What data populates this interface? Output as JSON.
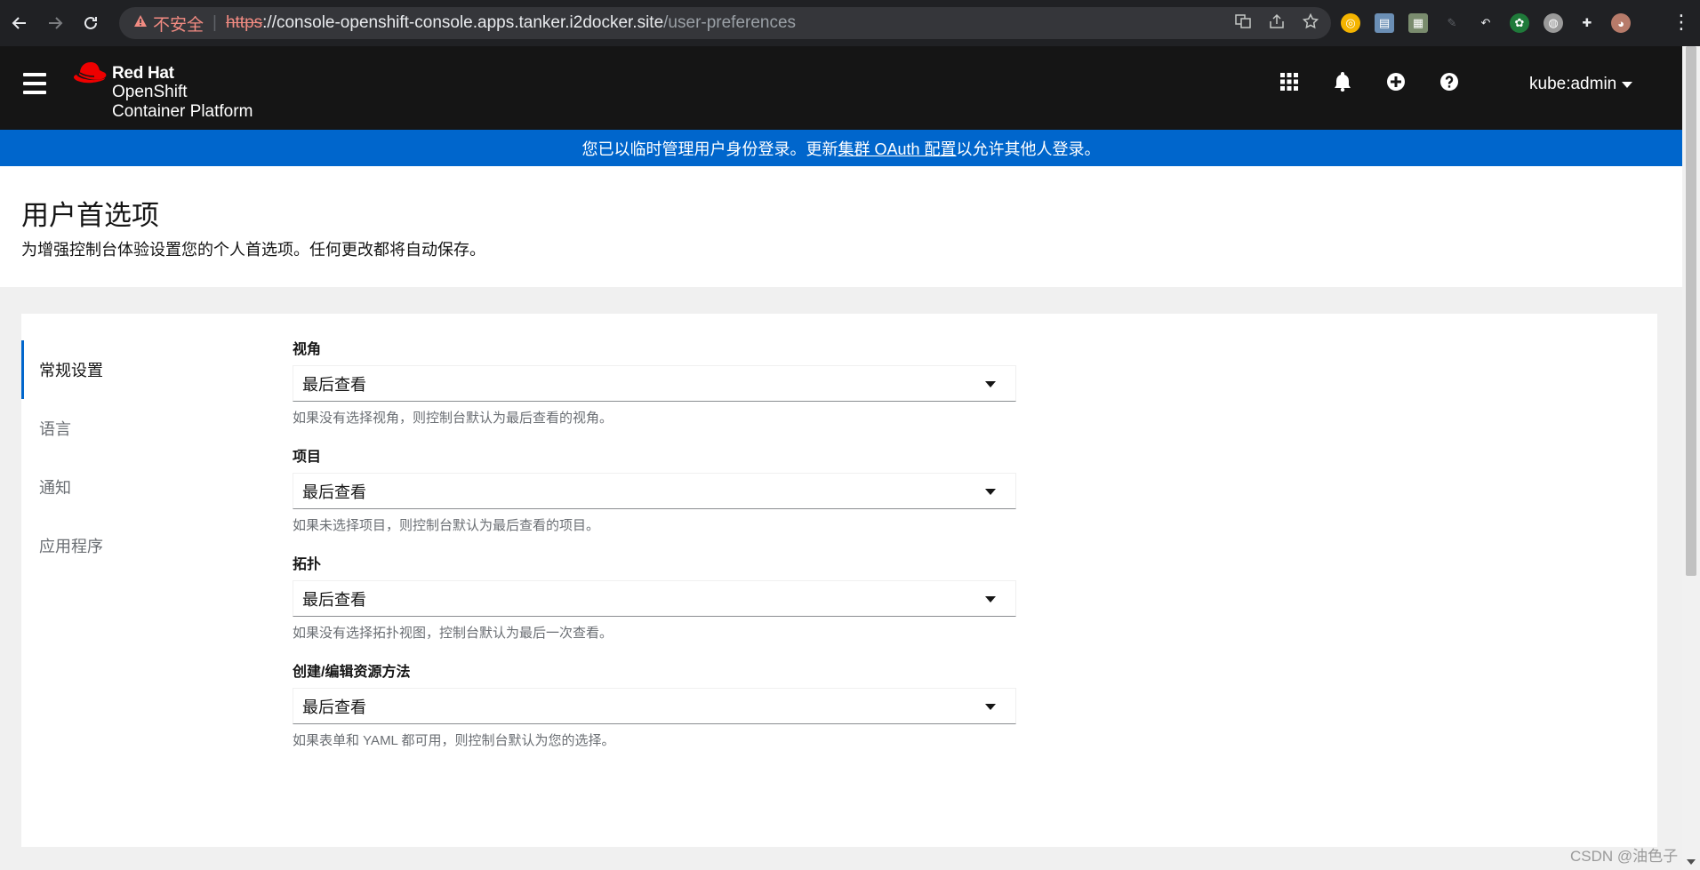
{
  "browser": {
    "insecure_label": "不安全",
    "url_scheme": "https",
    "url_host": "://console-openshift-console.apps.tanker.i2docker.site",
    "url_path": "/user-preferences"
  },
  "masthead": {
    "brand_line1": "Red Hat",
    "brand_line2": "OpenShift",
    "brand_line3": "Container Platform",
    "user": "kube:admin"
  },
  "banner": {
    "prefix": "您已以临时管理用户身份登录。更新",
    "link": "集群 OAuth 配置",
    "suffix": "以允许其他人登录。"
  },
  "page": {
    "title": "用户首选项",
    "description": "为增强控制台体验设置您的个人首选项。任何更改都将自动保存。"
  },
  "tabs": [
    {
      "label": "常规设置",
      "active": true
    },
    {
      "label": "语言",
      "active": false
    },
    {
      "label": "通知",
      "active": false
    },
    {
      "label": "应用程序",
      "active": false
    }
  ],
  "fields": [
    {
      "label": "视角",
      "value": "最后查看",
      "helper": "如果没有选择视角，则控制台默认为最后查看的视角。"
    },
    {
      "label": "项目",
      "value": "最后查看",
      "helper": "如果未选择项目，则控制台默认为最后查看的项目。"
    },
    {
      "label": "拓扑",
      "value": "最后查看",
      "helper": "如果没有选择拓扑视图，控制台默认为最后一次查看。"
    },
    {
      "label": "创建/编辑资源方法",
      "value": "最后查看",
      "helper": "如果表单和 YAML 都可用，则控制台默认为您的选择。"
    }
  ],
  "watermark": "CSDN @油色子",
  "colors": {
    "masthead": "#151515",
    "banner": "#0066cc",
    "accent": "#0066cc",
    "redhat_red": "#ee0000"
  }
}
